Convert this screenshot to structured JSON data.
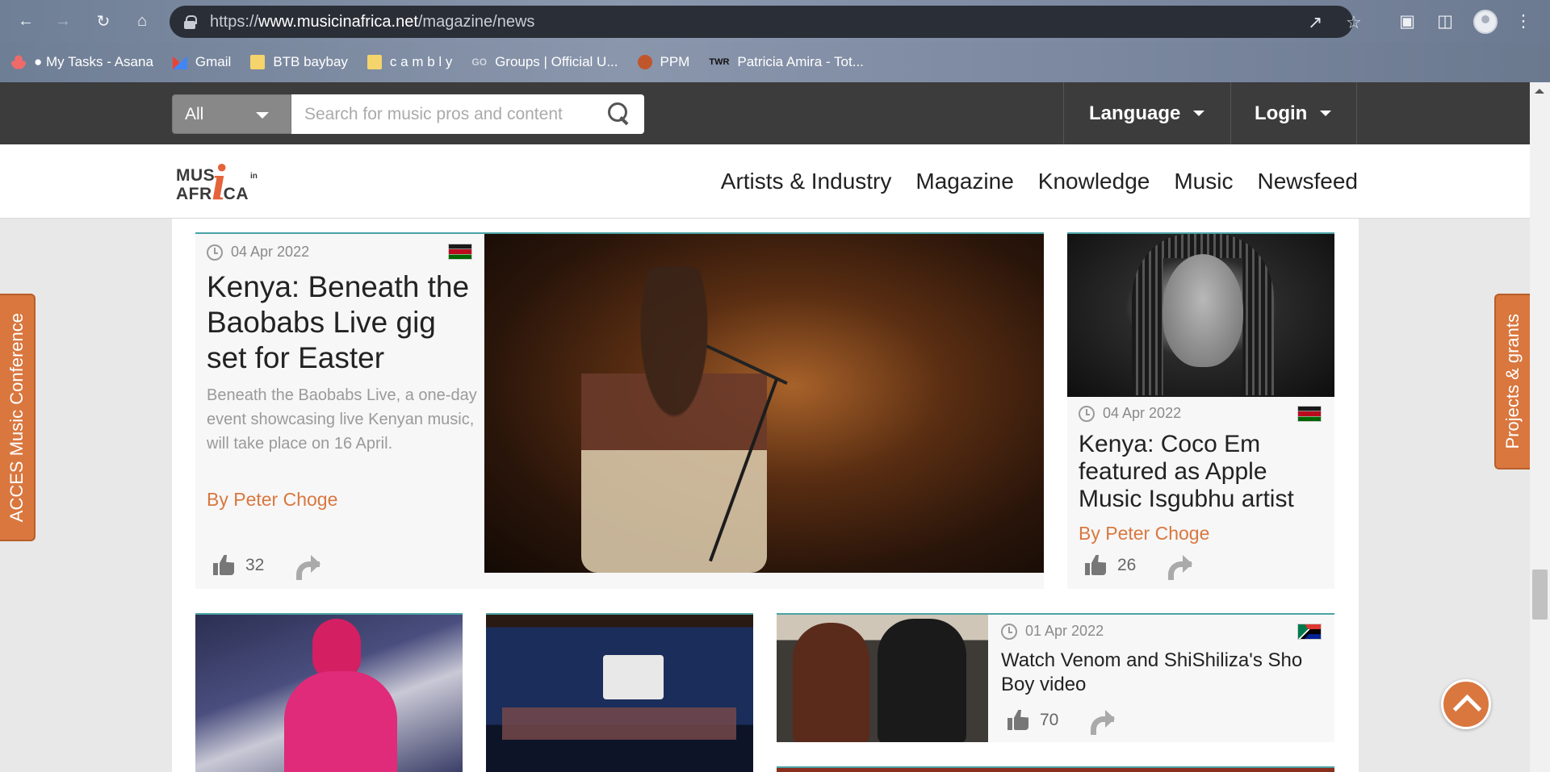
{
  "browser": {
    "url_scheme": "https://",
    "url_host": "www.musicinafrica.net",
    "url_path": "/magazine/news",
    "bookmarks": [
      {
        "label": "● My Tasks - Asana",
        "icon": "asana-icon"
      },
      {
        "label": "Gmail",
        "icon": "gmail-icon"
      },
      {
        "label": "BTB baybay",
        "icon": "folder-icon"
      },
      {
        "label": "c a m b l y",
        "icon": "folder-icon"
      },
      {
        "label": "Groups | Official U...",
        "icon": "go-icon"
      },
      {
        "label": "PPM",
        "icon": "ppm-icon"
      },
      {
        "label": "Patricia Amira - Tot...",
        "icon": "twr-icon"
      }
    ],
    "go_glyph": "GO",
    "twr_glyph": "TWR"
  },
  "topbar": {
    "search_scope": "All",
    "search_placeholder": "Search for music pros and content",
    "language_label": "Language",
    "login_label": "Login"
  },
  "logo": {
    "line1": "MUS",
    "line2": "AFR",
    "line2b": "CA",
    "in": "in",
    "i": "i"
  },
  "nav": {
    "items": [
      "Artists & Industry",
      "Magazine",
      "Knowledge",
      "Music",
      "Newsfeed"
    ]
  },
  "articles": {
    "featured": {
      "date": "04 Apr 2022",
      "title": "Kenya: Beneath the Baobabs Live gig set for Easter",
      "excerpt": "Beneath the Baobabs Live, a one-day event showcasing live Kenyan music, will take place on 16 April.",
      "byline": "By Peter Choge",
      "likes": "32",
      "flag": "kenya"
    },
    "coco": {
      "date": "04 Apr 2022",
      "title": "Kenya: Coco Em featured as Apple Music Isgubhu artist",
      "byline": "By Peter Choge",
      "likes": "26",
      "flag": "kenya"
    },
    "venom": {
      "date": "01 Apr 2022",
      "title": "Watch Venom and ShiShiliza's Sho Boy video",
      "likes": "70",
      "flag": "south-africa"
    }
  },
  "side_tabs": {
    "left": "ACCES Music Conference",
    "right": "Projects & grants"
  },
  "colors": {
    "accent_orange": "#d9773f",
    "topbar_dark": "#3c3c3c",
    "card_border_teal": "#4aa3a5"
  }
}
